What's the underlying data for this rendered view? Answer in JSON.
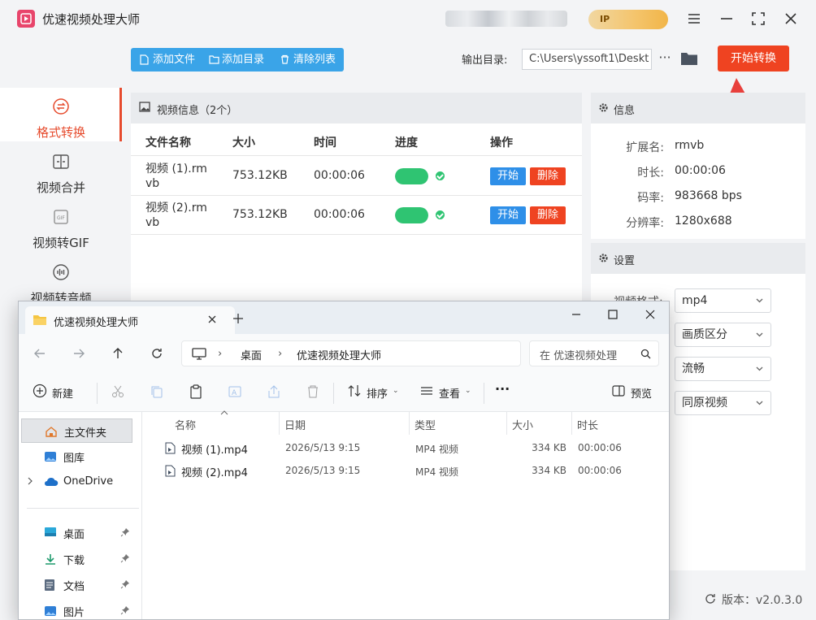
{
  "app": {
    "title": "优速视频处理大师",
    "ip_badge": "IP",
    "accent_color": "#ef4321",
    "primary_color": "#3aa4e8"
  },
  "sidebar": {
    "items": [
      {
        "label": "格式转换",
        "icon": "format-convert-icon",
        "active": true
      },
      {
        "label": "视频合并",
        "icon": "merge-icon",
        "active": false
      },
      {
        "label": "视频转GIF",
        "icon": "gif-icon",
        "active": false
      },
      {
        "label": "视频转音频",
        "icon": "audio-icon",
        "active": false
      }
    ]
  },
  "toolbar": {
    "add_file": "添加文件",
    "add_folder": "添加目录",
    "clear_list": "清除列表",
    "output_label": "输出目录:",
    "output_path": "C:\\Users\\yssoft1\\Deskt",
    "more": "···",
    "start": "开始转换"
  },
  "file_panel": {
    "title": "视频信息（2个）",
    "columns": [
      "文件名称",
      "大小",
      "时间",
      "进度",
      "操作"
    ],
    "rows": [
      {
        "name": "视频 (1).rmvb",
        "size": "753.12KB",
        "time": "00:00:06",
        "progress": 1.0,
        "op_start": "开始",
        "op_delete": "删除"
      },
      {
        "name": "视频 (2).rmvb",
        "size": "753.12KB",
        "time": "00:00:06",
        "progress": 1.0,
        "op_start": "开始",
        "op_delete": "删除"
      }
    ]
  },
  "info": {
    "title": "信息",
    "items": [
      {
        "key": "扩展名:",
        "value": "rmvb"
      },
      {
        "key": "时长:",
        "value": "00:00:06"
      },
      {
        "key": "码率:",
        "value": "983668 bps"
      },
      {
        "key": "分辨率:",
        "value": "1280x688"
      }
    ]
  },
  "settings": {
    "title": "设置",
    "format_label": "视频格式:",
    "selects": [
      "mp4",
      "画质区分",
      "流畅",
      "同原视频"
    ]
  },
  "version": "版本：v2.0.3.0",
  "explorer": {
    "tab_title": "优速视频处理大师",
    "breadcrumb": [
      "桌面",
      "优速视频处理大师"
    ],
    "search_placeholder": "在 优速视频处理",
    "commands": {
      "new": "新建",
      "sort": "排序",
      "view": "查看",
      "more": "···",
      "preview": "预览"
    },
    "nav": [
      {
        "label": "主文件夹",
        "icon": "home-icon"
      },
      {
        "label": "图库",
        "icon": "gallery-icon"
      },
      {
        "label": "OneDrive",
        "icon": "cloud-icon"
      },
      {
        "label": "桌面",
        "icon": "desktop-icon"
      },
      {
        "label": "下载",
        "icon": "download-icon"
      },
      {
        "label": "文档",
        "icon": "document-icon"
      },
      {
        "label": "图片",
        "icon": "picture-icon"
      }
    ],
    "columns": [
      "名称",
      "日期",
      "类型",
      "大小",
      "时长"
    ],
    "files": [
      {
        "name": "视频 (1).mp4",
        "date": "2026/5/13 9:15",
        "type": "MP4 视频",
        "size": "334 KB",
        "duration": "00:00:06"
      },
      {
        "name": "视频 (2).mp4",
        "date": "2026/5/13 9:15",
        "type": "MP4 视频",
        "size": "334 KB",
        "duration": "00:00:06"
      }
    ]
  }
}
